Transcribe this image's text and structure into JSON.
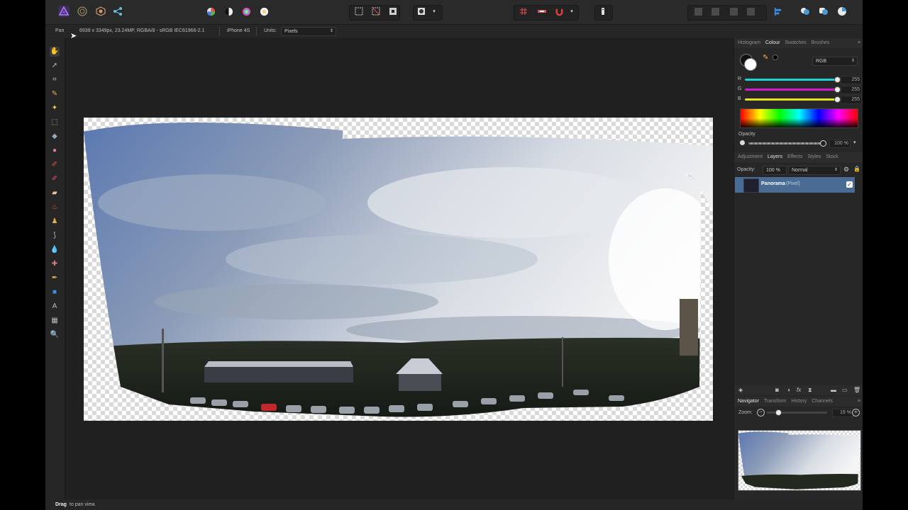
{
  "context": {
    "tool_name": "Pan",
    "doc_info": "6939 x 3349px, 23.24MP, RGBA/8 - sRGB IEC61966-2.1",
    "camera": "iPhone 4S",
    "units_label": "Units:",
    "units_value": "Pixels"
  },
  "colour_panel": {
    "tabs": [
      "Histogram",
      "Colour",
      "Swatches",
      "Brushes"
    ],
    "active_tab": "Colour",
    "mode": "RGB",
    "channels": [
      {
        "name": "R",
        "value": "255",
        "fraction": 1.0,
        "color": "#19d6d6"
      },
      {
        "name": "G",
        "value": "255",
        "fraction": 1.0,
        "color": "#d11bd1"
      },
      {
        "name": "B",
        "value": "255",
        "fraction": 1.0,
        "color": "#e6e619"
      }
    ],
    "opacity_label": "Opacity",
    "opacity_value": "100 %"
  },
  "layers_panel": {
    "tabs": [
      "Adjustment",
      "Layers",
      "Effects",
      "Styles",
      "Stock"
    ],
    "active_tab": "Layers",
    "opacity_label": "Opacity:",
    "opacity_value": "100 %",
    "blend_mode": "Normal",
    "layer_name": "Panorama",
    "layer_type": "(Pixel)",
    "layer_visible": true
  },
  "navigator_panel": {
    "tabs": [
      "Navigator",
      "Transform",
      "History",
      "Channels"
    ],
    "active_tab": "Navigator",
    "zoom_label": "Zoom:",
    "zoom_value": "19 %",
    "zoom_fraction": 0.19
  },
  "status": {
    "bold": "Drag",
    "text": "to pan view."
  },
  "colors": {
    "accent": "#4a6b94",
    "panel_bg": "#272727",
    "app_bg": "#222222"
  }
}
